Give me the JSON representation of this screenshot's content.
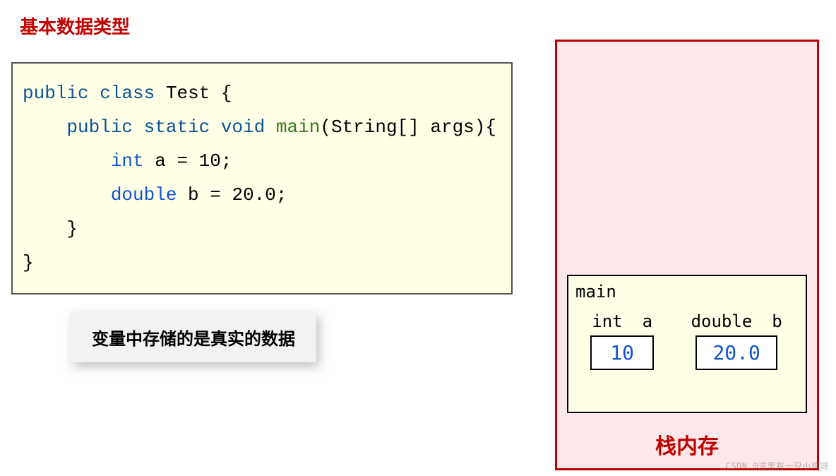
{
  "title": "基本数据类型",
  "code": {
    "l1_public": "public",
    "l1_class": "class",
    "l1_name": "Test {",
    "l2_public": "public",
    "l2_static": "static",
    "l2_void": "void",
    "l2_main": "main",
    "l2_sig": "(String[] args){",
    "l3_type": "int",
    "l3_rest": " a = 10;",
    "l4_type": "double",
    "l4_rest": " b = 20.0;",
    "l5": "    }",
    "l6": "}"
  },
  "callout": "变量中存储的是真实的数据",
  "stack": {
    "frame_label": "main",
    "vars": [
      {
        "type": "int",
        "name": "a",
        "value": "10"
      },
      {
        "type": "double",
        "name": "b",
        "value": "20.0"
      }
    ],
    "title": "栈内存"
  },
  "watermark": "CSDN @这里有一只小鸡呀"
}
